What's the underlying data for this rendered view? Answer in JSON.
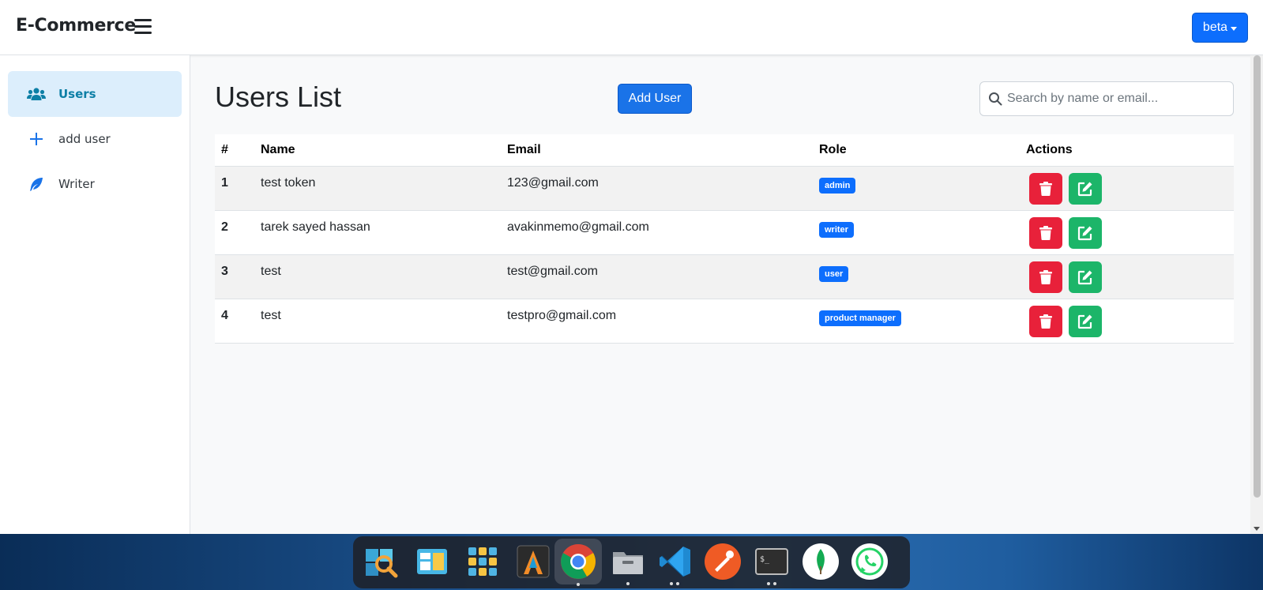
{
  "app": {
    "brand": "E-Commerce",
    "user_menu": "beta"
  },
  "sidebar": {
    "items": [
      {
        "label": "Users",
        "icon": "users-icon",
        "active": true
      },
      {
        "label": "add user",
        "icon": "plus-icon",
        "active": false
      },
      {
        "label": "Writer",
        "icon": "feather-icon",
        "active": false
      }
    ]
  },
  "main": {
    "title": "Users List",
    "add_button": "Add User",
    "search_placeholder": "Search by name or email..."
  },
  "table": {
    "headers": [
      "#",
      "Name",
      "Email",
      "Role",
      "Actions"
    ],
    "rows": [
      {
        "num": "1",
        "name": "test token",
        "email": "123@gmail.com",
        "role": "admin"
      },
      {
        "num": "2",
        "name": "tarek sayed hassan",
        "email": "avakinmemo@gmail.com",
        "role": "writer"
      },
      {
        "num": "3",
        "name": "test",
        "email": "test@gmail.com",
        "role": "user"
      },
      {
        "num": "4",
        "name": "test",
        "email": "testpro@gmail.com",
        "role": "product manager"
      }
    ]
  },
  "colors": {
    "primary": "#0d6efd",
    "danger": "#e8213a",
    "success": "#1cb569",
    "sidebar_active_bg": "#dceefc",
    "sidebar_active_text": "#0d7fa6"
  },
  "dock": {
    "apps": [
      "search-app-icon",
      "file-manager-icon",
      "app-grid-icon",
      "alacritty-icon",
      "chrome-icon",
      "files-icon",
      "vscode-icon",
      "postman-icon",
      "terminal-icon",
      "mongodb-compass-icon",
      "whatsapp-icon"
    ]
  }
}
